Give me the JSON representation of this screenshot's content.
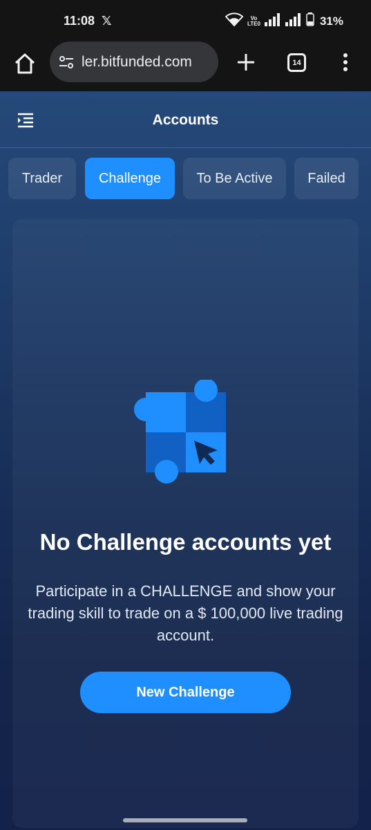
{
  "status_bar": {
    "time": "11:08",
    "app_icon": "x-icon",
    "volte_top": "Vo",
    "volte_bottom": "LTE0",
    "battery": "31%"
  },
  "browser": {
    "url": "ler.bitfunded.com",
    "tab_count": "14",
    "icons": [
      "home-icon",
      "site-settings-icon",
      "plus-icon",
      "tabs-icon",
      "more-vert-icon"
    ]
  },
  "header": {
    "title": "Accounts",
    "menu_icon": "sidebar-toggle-icon"
  },
  "tabs": [
    {
      "label": "Trader",
      "active": false
    },
    {
      "label": "Challenge",
      "active": true
    },
    {
      "label": "To Be Active",
      "active": false
    },
    {
      "label": "Failed",
      "active": false
    }
  ],
  "empty_state": {
    "title": "No Challenge accounts yet",
    "description": "Participate in a CHALLENGE and show your trading skill to trade on a $ 100,000 live trading account.",
    "button_label": "New Challenge"
  },
  "colors": {
    "accent": "#1f8fff",
    "background_top": "#25497a",
    "background_bottom": "#13224a"
  }
}
